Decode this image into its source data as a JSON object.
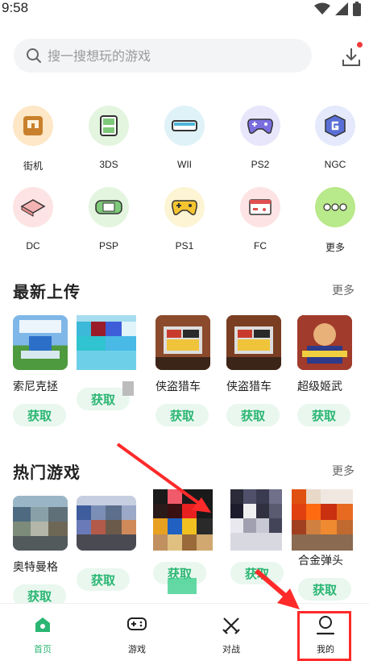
{
  "status_bar": {
    "time": "9:58"
  },
  "search": {
    "placeholder": "搜一搜想玩的游戏"
  },
  "platforms": [
    {
      "label": "街机",
      "icon": "arcade-icon",
      "bg": "#fde7c6"
    },
    {
      "label": "3DS",
      "icon": "3ds-icon",
      "bg": "#e3f5df"
    },
    {
      "label": "WII",
      "icon": "wii-icon",
      "bg": "#dff2f7"
    },
    {
      "label": "PS2",
      "icon": "gamepad-icon",
      "bg": "#e8e6fb"
    },
    {
      "label": "NGC",
      "icon": "gamecube-icon",
      "bg": "#e4e9fb"
    },
    {
      "label": "DC",
      "icon": "dreamcast-icon",
      "bg": "#fde3e3"
    },
    {
      "label": "PSP",
      "icon": "psp-icon",
      "bg": "#e3f5df"
    },
    {
      "label": "PS1",
      "icon": "ps1-controller-icon",
      "bg": "#fdf4d4"
    },
    {
      "label": "FC",
      "icon": "famicom-icon",
      "bg": "#fde3e3"
    },
    {
      "label": "更多",
      "icon": "more-icon",
      "bg": "#e3f5df"
    }
  ],
  "latest": {
    "title": "最新上传",
    "more": "更多",
    "games": [
      {
        "name": "索尼克拯",
        "button": "获取"
      },
      {
        "name": "",
        "button": "获取"
      },
      {
        "name": "侠盗猎车",
        "button": "获取"
      },
      {
        "name": "侠盗猎车",
        "button": "获取"
      },
      {
        "name": "超级姬武",
        "button": "获取"
      }
    ]
  },
  "hot": {
    "title": "热门游戏",
    "more": "更多",
    "games": [
      {
        "name": "奥特曼格",
        "button": "获取"
      },
      {
        "name": "",
        "button": "获取"
      },
      {
        "name": "",
        "button": "获取"
      },
      {
        "name": "",
        "button": "获取"
      },
      {
        "name": "合金弹头",
        "button": "获取"
      }
    ]
  },
  "bottom_nav": [
    {
      "label": "首页",
      "icon": "home-icon",
      "active": true
    },
    {
      "label": "游戏",
      "icon": "gamepad-icon",
      "active": false
    },
    {
      "label": "对战",
      "icon": "crossed-swords-icon",
      "active": false
    },
    {
      "label": "我的",
      "icon": "profile-icon",
      "active": false
    }
  ],
  "colors": {
    "accent": "#2bb673",
    "annotation": "#ff2a2a"
  }
}
